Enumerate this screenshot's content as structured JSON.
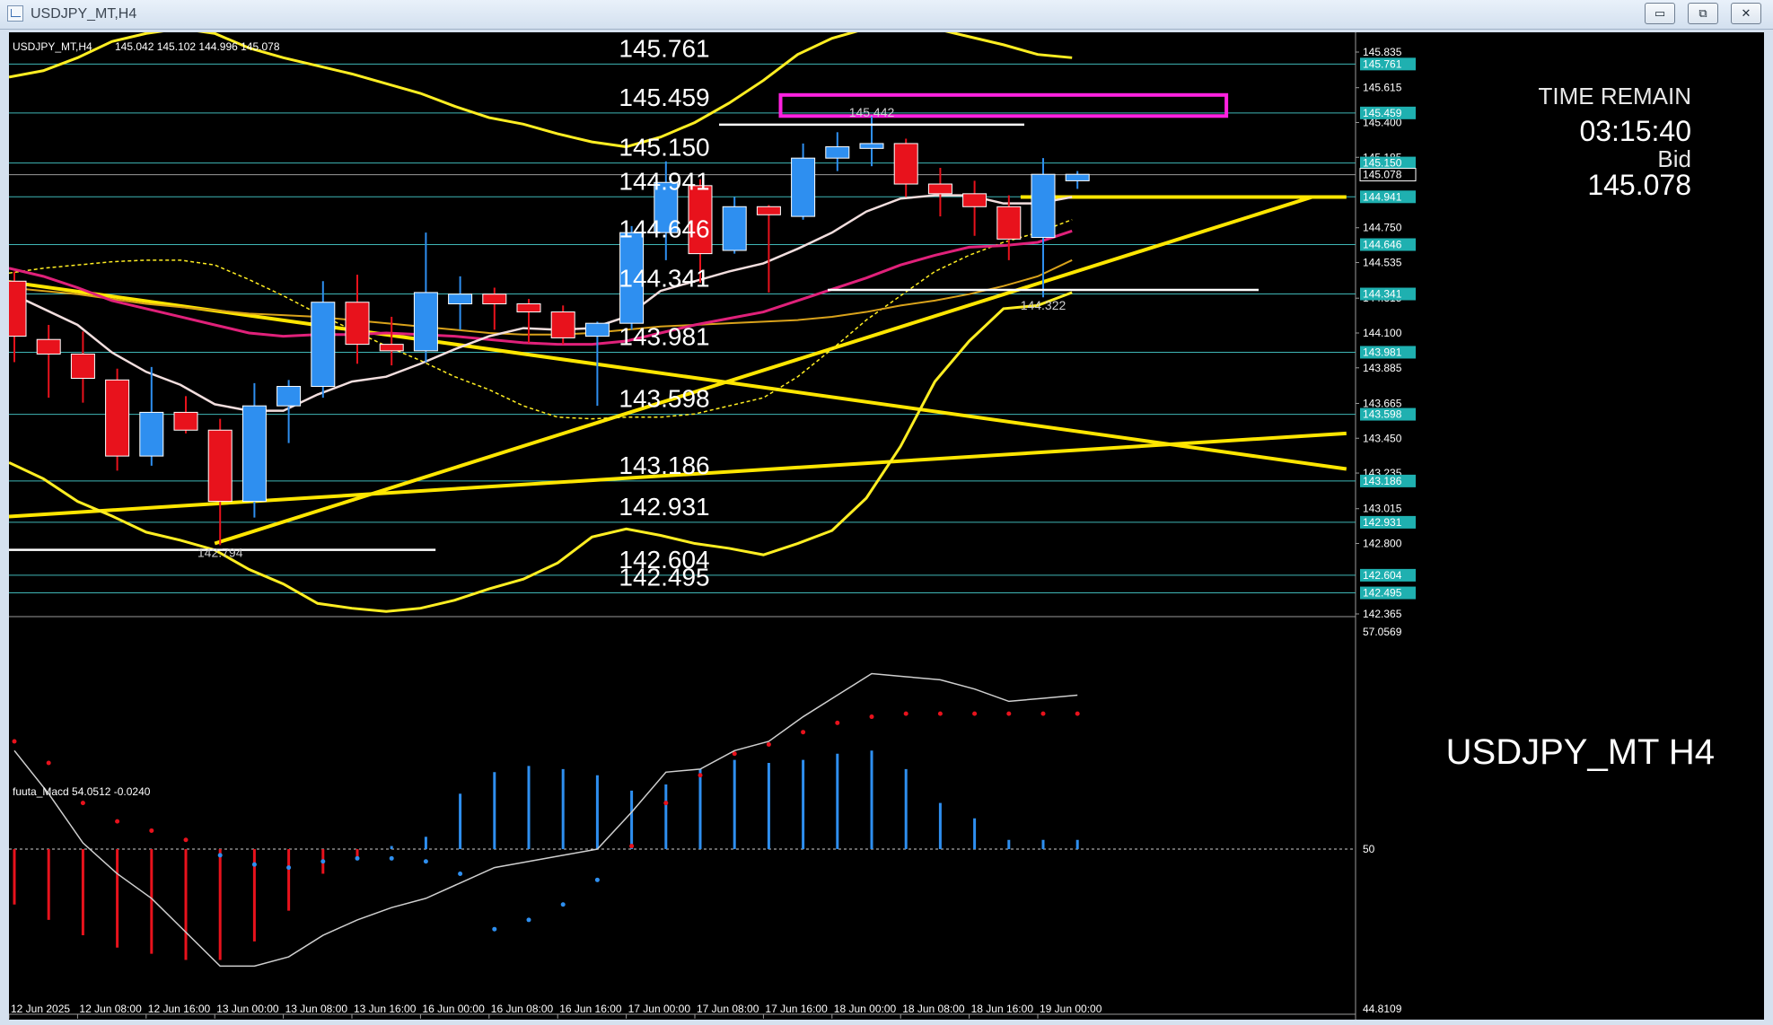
{
  "window": {
    "title": "USDJPY_MT,H4",
    "minimize_glyph": "▭",
    "restore_glyph": "⧉",
    "close_glyph": "✕"
  },
  "header": {
    "symbol_tf": "USDJPY_MT,H4",
    "ohlc": "145.042 145.102 144.996 145.078"
  },
  "info": {
    "time_remain_label": "TIME REMAIN",
    "time_remain": "03:15:40",
    "bid_label": "Bid",
    "bid": "145.078",
    "watermark": "USDJPY_MT H4"
  },
  "colors": {
    "background": "#000000",
    "bull": "#2e8ff0",
    "bear": "#e8121c",
    "level_line": "#3fb6b6",
    "level_label_bg": "#1fb0b0",
    "trendline": "#ffe600",
    "bollinger": "#ffee22",
    "ma_fast": "#f2dede",
    "ma_mid": "#e0217a",
    "ma_slow": "#d9a21b",
    "macd_line": "#cfcfcf",
    "highlight_box": "#ff22e0"
  },
  "chart_data": [
    {
      "type": "candlestick",
      "title": "USDJPY_MT,H4",
      "ylim": [
        142.365,
        145.835
      ],
      "price_axis_ticks": [
        "145.835",
        "145.615",
        "145.400",
        "145.185",
        "144.750",
        "144.535",
        "144.315",
        "144.100",
        "143.885",
        "143.665",
        "143.450",
        "143.235",
        "143.015",
        "142.800",
        "142.365"
      ],
      "time_axis_labels": [
        "12 Jun 2025",
        "12 Jun 08:00",
        "12 Jun 16:00",
        "13 Jun 00:00",
        "13 Jun 08:00",
        "13 Jun 16:00",
        "16 Jun 00:00",
        "16 Jun 08:00",
        "16 Jun 16:00",
        "17 Jun 00:00",
        "17 Jun 08:00",
        "17 Jun 16:00",
        "18 Jun 00:00",
        "18 Jun 08:00",
        "18 Jun 16:00",
        "19 Jun 00:00"
      ],
      "candles": [
        {
          "o": 144.42,
          "h": 144.48,
          "l": 143.92,
          "c": 144.08
        },
        {
          "o": 144.06,
          "h": 144.15,
          "l": 143.7,
          "c": 143.97
        },
        {
          "o": 143.97,
          "h": 144.11,
          "l": 143.67,
          "c": 143.82
        },
        {
          "o": 143.81,
          "h": 143.88,
          "l": 143.25,
          "c": 143.34
        },
        {
          "o": 143.34,
          "h": 143.89,
          "l": 143.28,
          "c": 143.61
        },
        {
          "o": 143.61,
          "h": 143.71,
          "l": 143.48,
          "c": 143.5
        },
        {
          "o": 143.5,
          "h": 143.57,
          "l": 142.79,
          "c": 143.06
        },
        {
          "o": 143.06,
          "h": 143.79,
          "l": 142.96,
          "c": 143.65
        },
        {
          "o": 143.65,
          "h": 143.81,
          "l": 143.42,
          "c": 143.77
        },
        {
          "o": 143.77,
          "h": 144.42,
          "l": 143.7,
          "c": 144.29
        },
        {
          "o": 144.29,
          "h": 144.46,
          "l": 143.91,
          "c": 144.03
        },
        {
          "o": 144.03,
          "h": 144.2,
          "l": 143.9,
          "c": 143.99
        },
        {
          "o": 143.99,
          "h": 144.72,
          "l": 143.92,
          "c": 144.35
        },
        {
          "o": 144.28,
          "h": 144.45,
          "l": 144.12,
          "c": 144.34
        },
        {
          "o": 144.34,
          "h": 144.38,
          "l": 144.12,
          "c": 144.28
        },
        {
          "o": 144.28,
          "h": 144.31,
          "l": 144.04,
          "c": 144.23
        },
        {
          "o": 144.23,
          "h": 144.27,
          "l": 144.03,
          "c": 144.07
        },
        {
          "o": 144.08,
          "h": 144.17,
          "l": 143.65,
          "c": 144.16
        },
        {
          "o": 144.16,
          "h": 144.76,
          "l": 144.12,
          "c": 144.72
        },
        {
          "o": 144.72,
          "h": 145.16,
          "l": 144.55,
          "c": 145.03
        },
        {
          "o": 145.01,
          "h": 145.05,
          "l": 144.41,
          "c": 144.59
        },
        {
          "o": 144.61,
          "h": 144.94,
          "l": 144.59,
          "c": 144.88
        },
        {
          "o": 144.88,
          "h": 144.89,
          "l": 144.35,
          "c": 144.83
        },
        {
          "o": 144.82,
          "h": 145.27,
          "l": 144.8,
          "c": 145.18
        },
        {
          "o": 145.18,
          "h": 145.34,
          "l": 145.1,
          "c": 145.25
        },
        {
          "o": 145.24,
          "h": 145.44,
          "l": 145.13,
          "c": 145.27
        },
        {
          "o": 145.27,
          "h": 145.3,
          "l": 144.94,
          "c": 145.02
        },
        {
          "o": 145.02,
          "h": 145.12,
          "l": 144.82,
          "c": 144.96
        },
        {
          "o": 144.96,
          "h": 145.04,
          "l": 144.7,
          "c": 144.88
        },
        {
          "o": 144.88,
          "h": 144.95,
          "l": 144.55,
          "c": 144.68
        },
        {
          "o": 144.69,
          "h": 145.18,
          "l": 144.32,
          "c": 145.08
        },
        {
          "o": 145.04,
          "h": 145.1,
          "l": 144.99,
          "c": 145.08
        }
      ],
      "ma_fast": [
        144.35,
        144.25,
        144.15,
        143.98,
        143.86,
        143.78,
        143.66,
        143.62,
        143.62,
        143.72,
        143.8,
        143.83,
        143.91,
        144.0,
        144.08,
        144.13,
        144.12,
        144.13,
        144.2,
        144.36,
        144.42,
        144.48,
        144.53,
        144.62,
        144.72,
        144.85,
        144.93,
        144.95,
        144.95,
        144.9,
        144.9,
        144.94
      ],
      "ma_mid": [
        144.5,
        144.45,
        144.38,
        144.3,
        144.25,
        144.2,
        144.15,
        144.1,
        144.08,
        144.09,
        144.09,
        144.1,
        144.09,
        144.08,
        144.06,
        144.04,
        144.03,
        144.03,
        144.05,
        144.1,
        144.15,
        144.19,
        144.23,
        144.3,
        144.37,
        144.44,
        144.52,
        144.58,
        144.63,
        144.64,
        144.66,
        144.73
      ],
      "ma_slow": [
        144.38,
        144.36,
        144.34,
        144.31,
        144.28,
        144.26,
        144.24,
        144.22,
        144.21,
        144.2,
        144.18,
        144.16,
        144.14,
        144.12,
        144.1,
        144.09,
        144.09,
        144.1,
        144.12,
        144.14,
        144.15,
        144.16,
        144.17,
        144.18,
        144.2,
        144.23,
        144.27,
        144.3,
        144.34,
        144.39,
        144.45,
        144.55
      ],
      "bb_upper": [
        145.68,
        145.72,
        145.8,
        145.9,
        145.95,
        145.98,
        145.95,
        145.86,
        145.8,
        145.75,
        145.7,
        145.64,
        145.58,
        145.5,
        145.43,
        145.39,
        145.33,
        145.28,
        145.25,
        145.31,
        145.4,
        145.52,
        145.66,
        145.82,
        145.92,
        145.98,
        146.0,
        145.98,
        145.93,
        145.88,
        145.82,
        145.8
      ],
      "bb_mid": [
        144.47,
        144.5,
        144.52,
        144.54,
        144.55,
        144.55,
        144.52,
        144.43,
        144.33,
        144.22,
        144.12,
        144.02,
        143.93,
        143.83,
        143.75,
        143.65,
        143.58,
        143.57,
        143.58,
        143.58,
        143.6,
        143.65,
        143.7,
        143.83,
        144.0,
        144.18,
        144.33,
        144.48,
        144.58,
        144.66,
        144.72,
        144.8
      ],
      "bb_lower": [
        143.3,
        143.2,
        143.06,
        142.97,
        142.87,
        142.82,
        142.76,
        142.64,
        142.55,
        142.43,
        142.4,
        142.38,
        142.4,
        142.45,
        142.52,
        142.58,
        142.68,
        142.84,
        142.89,
        142.85,
        142.8,
        142.77,
        142.73,
        142.8,
        142.88,
        143.08,
        143.4,
        143.8,
        144.05,
        144.25,
        144.27,
        144.35
      ],
      "fib_levels": [
        "145.761",
        "145.459",
        "145.150",
        "144.941",
        "144.646",
        "144.341",
        "143.981",
        "143.598",
        "143.186",
        "142.931",
        "142.604",
        "142.495"
      ],
      "current_price": "145.078",
      "swing_labels": [
        {
          "text": "142.794",
          "candle": 6,
          "price": 142.794
        },
        {
          "text": "145.442",
          "candle": 25,
          "price": 145.442
        },
        {
          "text": "144.322",
          "candle": 30,
          "price": 144.322
        }
      ],
      "trendlines": [
        {
          "from": [
            -0.5,
            144.43
          ],
          "to": [
            39,
            143.26
          ]
        },
        {
          "from": [
            -0.5,
            142.96
          ],
          "to": [
            39,
            143.48
          ]
        },
        {
          "from": [
            6,
            142.8
          ],
          "to": [
            38,
            144.94
          ]
        },
        {
          "from": [
            29.5,
            144.94
          ],
          "to": [
            39,
            144.94
          ]
        }
      ],
      "highlight_zone": [
        145.44,
        145.57
      ]
    },
    {
      "type": "macd",
      "label": "fuuta_Macd 54.0512  -0.0240",
      "ylim": [
        44.8109,
        57.0569
      ],
      "axis_ticks": [
        "57.0569",
        "50",
        "44.8109"
      ],
      "histogram": [
        -1.8,
        -2.3,
        -2.8,
        -3.2,
        -3.4,
        -3.6,
        -3.6,
        -3.0,
        -2.0,
        -0.8,
        -0.3,
        0.1,
        0.4,
        1.8,
        2.5,
        2.7,
        2.6,
        2.4,
        1.9,
        2.1,
        2.6,
        2.9,
        2.8,
        2.9,
        3.1,
        3.2,
        2.6,
        1.5,
        1.0,
        0.3,
        0.3,
        0.3
      ],
      "signal_dots": [
        3.5,
        2.8,
        1.5,
        0.9,
        0.6,
        0.3,
        -0.2,
        -0.5,
        -0.6,
        -0.4,
        -0.3,
        -0.3,
        -0.4,
        -0.8,
        -2.6,
        -2.3,
        -1.8,
        -1.0,
        0.1,
        1.5,
        2.4,
        3.1,
        3.4,
        3.8,
        4.1,
        4.3,
        4.4,
        4.4,
        4.4,
        4.4,
        4.4,
        4.4
      ],
      "line": [
        3.2,
        1.8,
        0.2,
        -0.8,
        -1.6,
        -2.7,
        -3.8,
        -3.8,
        -3.5,
        -2.8,
        -2.3,
        -1.9,
        -1.6,
        -1.1,
        -0.6,
        -0.4,
        -0.2,
        0.0,
        1.2,
        2.5,
        2.6,
        3.2,
        3.5,
        4.3,
        5.0,
        5.7,
        5.6,
        5.5,
        5.2,
        4.8,
        4.9,
        5.0
      ]
    }
  ]
}
